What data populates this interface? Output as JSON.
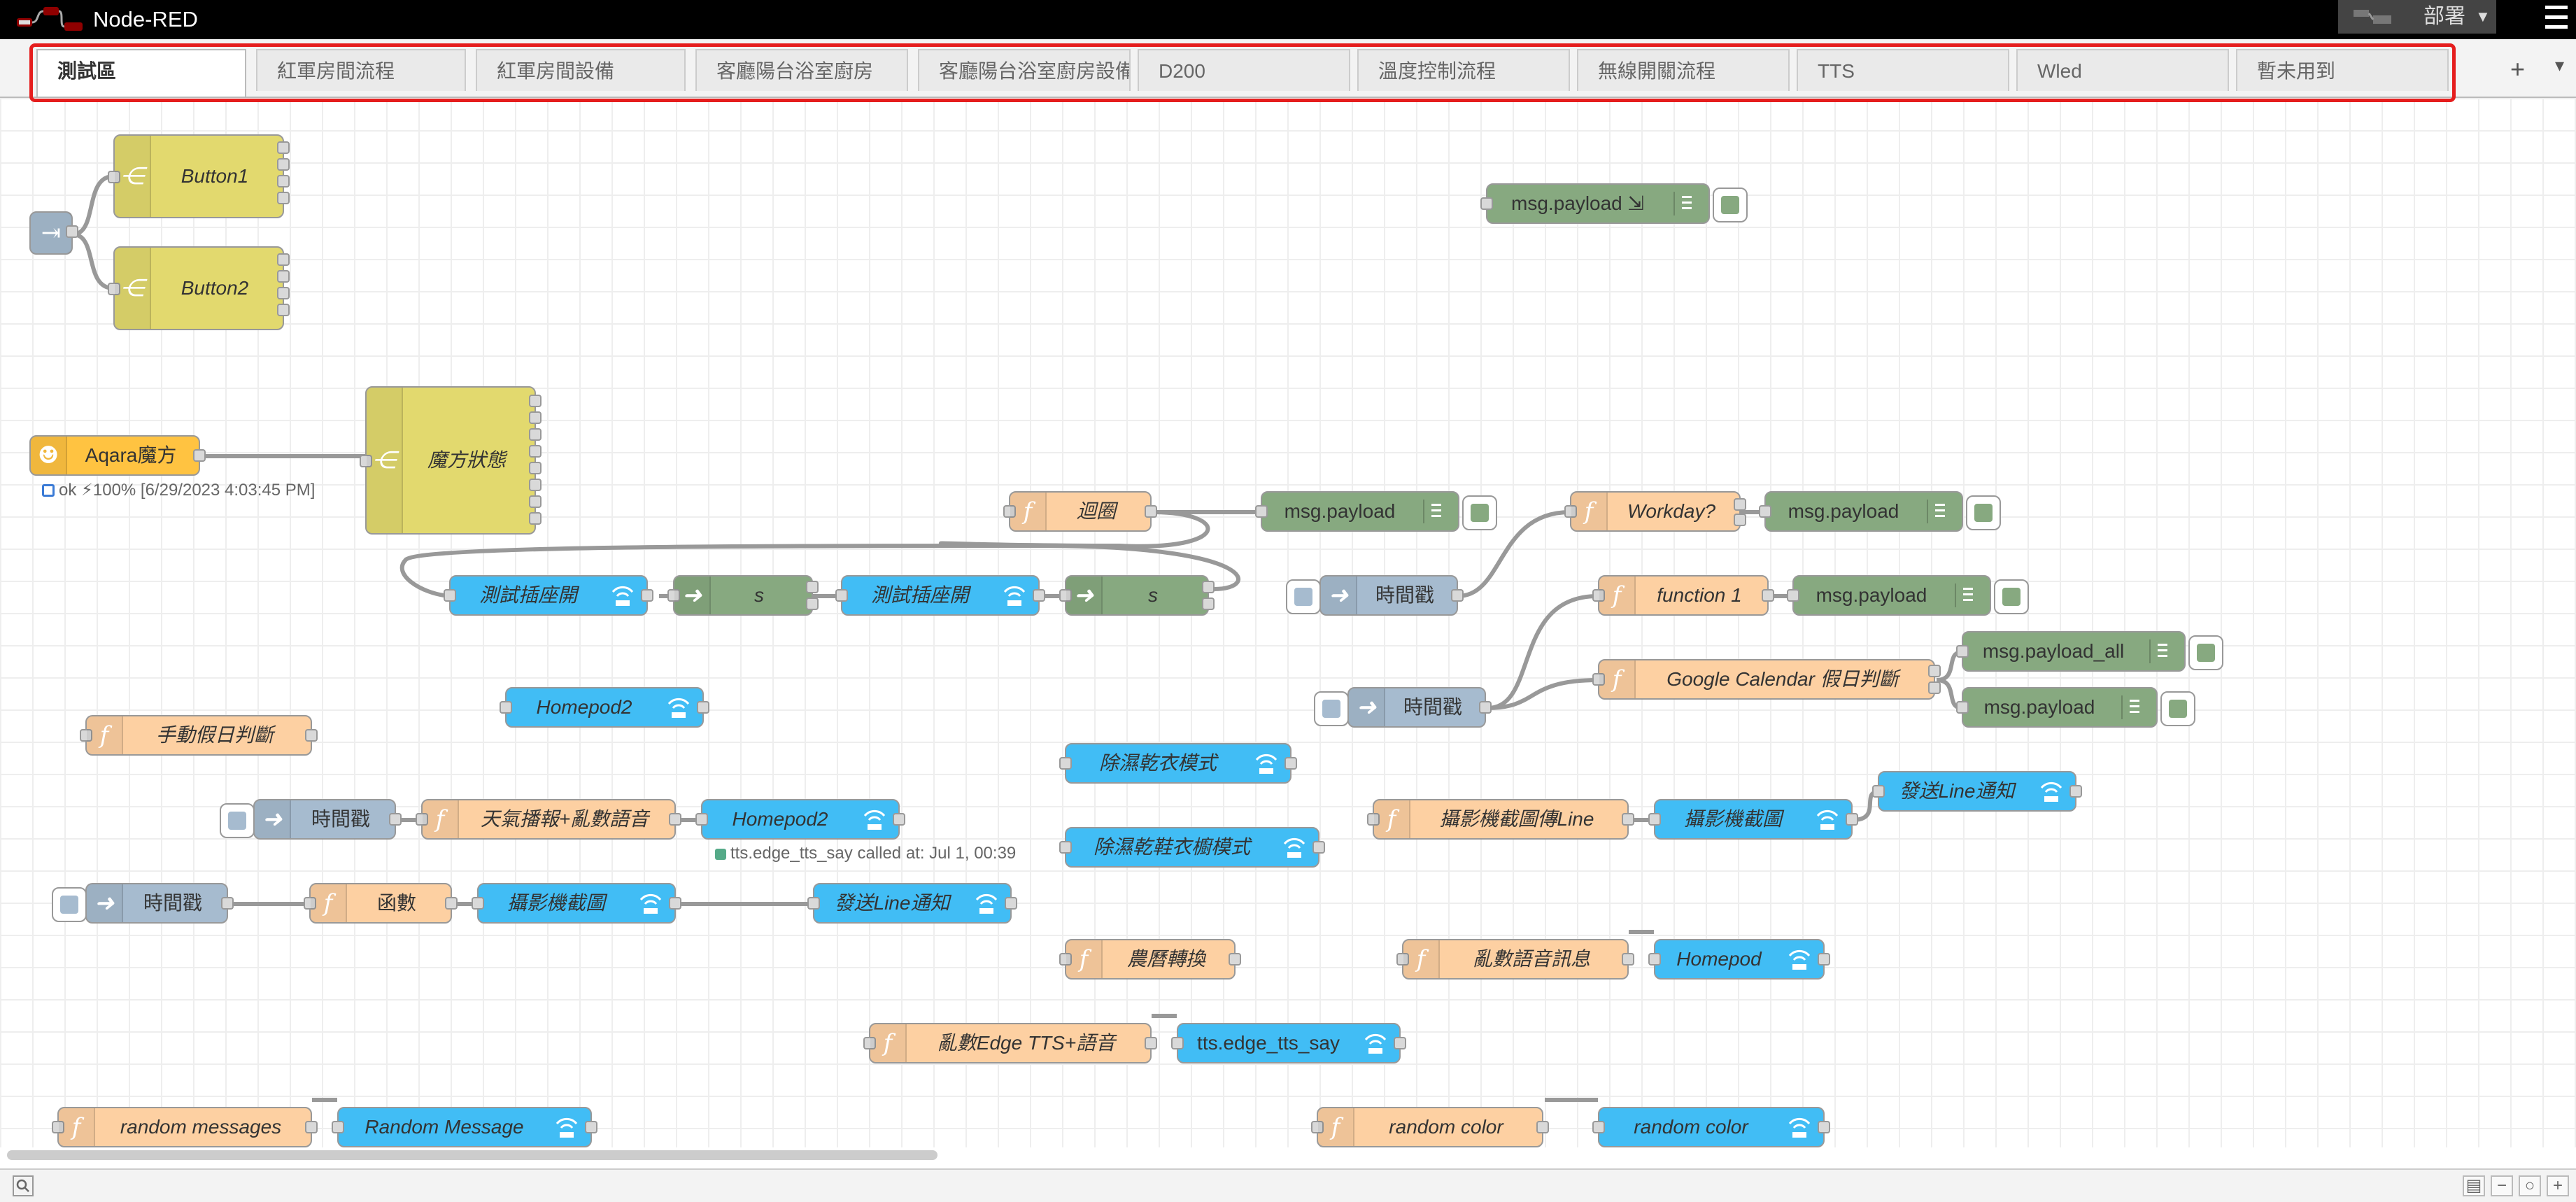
{
  "header": {
    "title": "Node-RED",
    "deploy_label": "部署"
  },
  "tabs": [
    {
      "label": "測試區"
    },
    {
      "label": "紅軍房間流程"
    },
    {
      "label": "紅軍房間設備"
    },
    {
      "label": "客廳陽台浴室廚房"
    },
    {
      "label": "客廳陽台浴室廚房設備"
    },
    {
      "label": "D200"
    },
    {
      "label": "溫度控制流程"
    },
    {
      "label": "無線開關流程"
    },
    {
      "label": "TTS"
    },
    {
      "label": "Wled"
    },
    {
      "label": "暫未用到"
    }
  ],
  "tab_controls": {
    "add": "+",
    "menu": "▾"
  },
  "colors": {
    "function": "#fdd0a2",
    "debug": "#87a980",
    "inject": "#a6bbcf",
    "switch": "#e2d96e",
    "home_assistant": "#41bdf5",
    "aqara": "#ffc341",
    "tab_highlight": "#e51d1d"
  },
  "nodes": {
    "button1": "Button1",
    "button2": "Button2",
    "msg_payload_top": "msg.payload ⇲",
    "aqara": "Aqara魔方",
    "aqara_status": "ok ⚡100% [6/29/2023 4:03:45 PM]",
    "cube_state": "魔方狀態",
    "loop": "迴圈",
    "msg_payload_loop": "msg.payload",
    "workday": "Workday?",
    "msg_payload_workday": "msg.payload",
    "test_plug_1": "測試插座開",
    "s1": "s",
    "test_plug_2": "測試插座開",
    "s2": "s",
    "timestamp_1": "時間戳",
    "function1": "function 1",
    "msg_payload_func1": "msg.payload",
    "msg_payload_all": "msg.payload_all",
    "timestamp_2": "時間戳",
    "gcal_holiday": "Google Calendar 假日判斷",
    "msg_payload_gcal": "msg.payload",
    "homepod2_a": "Homepod2",
    "manual_holiday": "手動假日判斷",
    "dehumid_clothes": "除濕乾衣模式",
    "timestamp_3": "時間戳",
    "weather_tts": "天氣播報+亂數語音",
    "homepod2_b": "Homepod2",
    "homepod2_status": "tts.edge_tts_say called at: Jul 1, 00:39",
    "camera_line_func": "攝影機截圖傳Line",
    "camera_snapshot_a": "攝影機截圖",
    "send_line_a": "發送Line通知",
    "dehumid_shoes": "除濕乾鞋衣櫥模式",
    "timestamp_4": "時間戳",
    "func_cn": "函數",
    "camera_snapshot_b": "攝影機截圖",
    "send_line_b": "發送Line通知",
    "lunar": "農曆轉換",
    "random_voice": "亂數語音訊息",
    "homepod": "Homepod",
    "random_edge_tts": "亂數Edge TTS+語音",
    "tts_edge_say": "tts.edge_tts_say",
    "random_messages": "random messages",
    "random_message": "Random Message",
    "random_color_func": "random color",
    "random_color": "random color"
  },
  "footer": {
    "zoom_out": "−",
    "zoom_reset": "○",
    "zoom_in": "+"
  }
}
